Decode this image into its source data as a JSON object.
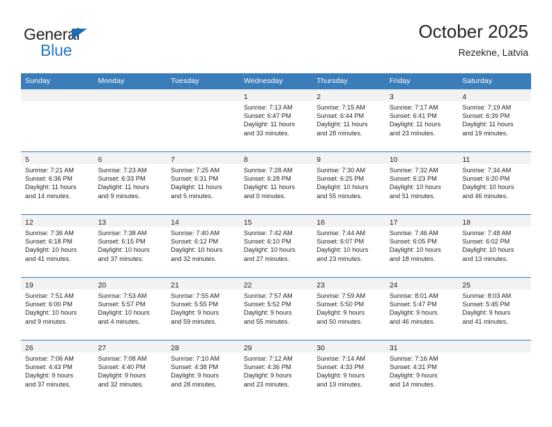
{
  "brand": {
    "name_top": "General",
    "name_bottom": "Blue",
    "triangle_icon": "triangle-icon",
    "accent_color": "#1f76c4"
  },
  "header": {
    "title": "October 2025",
    "subtitle": "Rezekne, Latvia"
  },
  "theme": {
    "header_bg": "#3b7cba",
    "header_text": "#ffffff",
    "daynum_band_bg": "#f2f2f2",
    "cell_bg": "#ffffff",
    "text": "#231f20"
  },
  "weekday_headers": [
    "Sunday",
    "Monday",
    "Tuesday",
    "Wednesday",
    "Thursday",
    "Friday",
    "Saturday"
  ],
  "labels": {
    "sunrise_prefix": "Sunrise:",
    "sunset_prefix": "Sunset:",
    "daylight_prefix": "Daylight:"
  },
  "weeks": [
    [
      {
        "empty": true
      },
      {
        "empty": true
      },
      {
        "empty": true
      },
      {
        "day": "1",
        "sunrise": "Sunrise: 7:13 AM",
        "sunset": "Sunset: 6:47 PM",
        "daylight_line1": "Daylight: 11 hours",
        "daylight_line2": "and 33 minutes."
      },
      {
        "day": "2",
        "sunrise": "Sunrise: 7:15 AM",
        "sunset": "Sunset: 6:44 PM",
        "daylight_line1": "Daylight: 11 hours",
        "daylight_line2": "and 28 minutes."
      },
      {
        "day": "3",
        "sunrise": "Sunrise: 7:17 AM",
        "sunset": "Sunset: 6:41 PM",
        "daylight_line1": "Daylight: 11 hours",
        "daylight_line2": "and 23 minutes."
      },
      {
        "day": "4",
        "sunrise": "Sunrise: 7:19 AM",
        "sunset": "Sunset: 6:39 PM",
        "daylight_line1": "Daylight: 11 hours",
        "daylight_line2": "and 19 minutes."
      }
    ],
    [
      {
        "day": "5",
        "sunrise": "Sunrise: 7:21 AM",
        "sunset": "Sunset: 6:36 PM",
        "daylight_line1": "Daylight: 11 hours",
        "daylight_line2": "and 14 minutes."
      },
      {
        "day": "6",
        "sunrise": "Sunrise: 7:23 AM",
        "sunset": "Sunset: 6:33 PM",
        "daylight_line1": "Daylight: 11 hours",
        "daylight_line2": "and 9 minutes."
      },
      {
        "day": "7",
        "sunrise": "Sunrise: 7:25 AM",
        "sunset": "Sunset: 6:31 PM",
        "daylight_line1": "Daylight: 11 hours",
        "daylight_line2": "and 5 minutes."
      },
      {
        "day": "8",
        "sunrise": "Sunrise: 7:28 AM",
        "sunset": "Sunset: 6:28 PM",
        "daylight_line1": "Daylight: 11 hours",
        "daylight_line2": "and 0 minutes."
      },
      {
        "day": "9",
        "sunrise": "Sunrise: 7:30 AM",
        "sunset": "Sunset: 6:25 PM",
        "daylight_line1": "Daylight: 10 hours",
        "daylight_line2": "and 55 minutes."
      },
      {
        "day": "10",
        "sunrise": "Sunrise: 7:32 AM",
        "sunset": "Sunset: 6:23 PM",
        "daylight_line1": "Daylight: 10 hours",
        "daylight_line2": "and 51 minutes."
      },
      {
        "day": "11",
        "sunrise": "Sunrise: 7:34 AM",
        "sunset": "Sunset: 6:20 PM",
        "daylight_line1": "Daylight: 10 hours",
        "daylight_line2": "and 46 minutes."
      }
    ],
    [
      {
        "day": "12",
        "sunrise": "Sunrise: 7:36 AM",
        "sunset": "Sunset: 6:18 PM",
        "daylight_line1": "Daylight: 10 hours",
        "daylight_line2": "and 41 minutes."
      },
      {
        "day": "13",
        "sunrise": "Sunrise: 7:38 AM",
        "sunset": "Sunset: 6:15 PM",
        "daylight_line1": "Daylight: 10 hours",
        "daylight_line2": "and 37 minutes."
      },
      {
        "day": "14",
        "sunrise": "Sunrise: 7:40 AM",
        "sunset": "Sunset: 6:12 PM",
        "daylight_line1": "Daylight: 10 hours",
        "daylight_line2": "and 32 minutes."
      },
      {
        "day": "15",
        "sunrise": "Sunrise: 7:42 AM",
        "sunset": "Sunset: 6:10 PM",
        "daylight_line1": "Daylight: 10 hours",
        "daylight_line2": "and 27 minutes."
      },
      {
        "day": "16",
        "sunrise": "Sunrise: 7:44 AM",
        "sunset": "Sunset: 6:07 PM",
        "daylight_line1": "Daylight: 10 hours",
        "daylight_line2": "and 23 minutes."
      },
      {
        "day": "17",
        "sunrise": "Sunrise: 7:46 AM",
        "sunset": "Sunset: 6:05 PM",
        "daylight_line1": "Daylight: 10 hours",
        "daylight_line2": "and 18 minutes."
      },
      {
        "day": "18",
        "sunrise": "Sunrise: 7:48 AM",
        "sunset": "Sunset: 6:02 PM",
        "daylight_line1": "Daylight: 10 hours",
        "daylight_line2": "and 13 minutes."
      }
    ],
    [
      {
        "day": "19",
        "sunrise": "Sunrise: 7:51 AM",
        "sunset": "Sunset: 6:00 PM",
        "daylight_line1": "Daylight: 10 hours",
        "daylight_line2": "and 9 minutes."
      },
      {
        "day": "20",
        "sunrise": "Sunrise: 7:53 AM",
        "sunset": "Sunset: 5:57 PM",
        "daylight_line1": "Daylight: 10 hours",
        "daylight_line2": "and 4 minutes."
      },
      {
        "day": "21",
        "sunrise": "Sunrise: 7:55 AM",
        "sunset": "Sunset: 5:55 PM",
        "daylight_line1": "Daylight: 9 hours",
        "daylight_line2": "and 59 minutes."
      },
      {
        "day": "22",
        "sunrise": "Sunrise: 7:57 AM",
        "sunset": "Sunset: 5:52 PM",
        "daylight_line1": "Daylight: 9 hours",
        "daylight_line2": "and 55 minutes."
      },
      {
        "day": "23",
        "sunrise": "Sunrise: 7:59 AM",
        "sunset": "Sunset: 5:50 PM",
        "daylight_line1": "Daylight: 9 hours",
        "daylight_line2": "and 50 minutes."
      },
      {
        "day": "24",
        "sunrise": "Sunrise: 8:01 AM",
        "sunset": "Sunset: 5:47 PM",
        "daylight_line1": "Daylight: 9 hours",
        "daylight_line2": "and 46 minutes."
      },
      {
        "day": "25",
        "sunrise": "Sunrise: 8:03 AM",
        "sunset": "Sunset: 5:45 PM",
        "daylight_line1": "Daylight: 9 hours",
        "daylight_line2": "and 41 minutes."
      }
    ],
    [
      {
        "day": "26",
        "sunrise": "Sunrise: 7:06 AM",
        "sunset": "Sunset: 4:43 PM",
        "daylight_line1": "Daylight: 9 hours",
        "daylight_line2": "and 37 minutes."
      },
      {
        "day": "27",
        "sunrise": "Sunrise: 7:08 AM",
        "sunset": "Sunset: 4:40 PM",
        "daylight_line1": "Daylight: 9 hours",
        "daylight_line2": "and 32 minutes."
      },
      {
        "day": "28",
        "sunrise": "Sunrise: 7:10 AM",
        "sunset": "Sunset: 4:38 PM",
        "daylight_line1": "Daylight: 9 hours",
        "daylight_line2": "and 28 minutes."
      },
      {
        "day": "29",
        "sunrise": "Sunrise: 7:12 AM",
        "sunset": "Sunset: 4:36 PM",
        "daylight_line1": "Daylight: 9 hours",
        "daylight_line2": "and 23 minutes."
      },
      {
        "day": "30",
        "sunrise": "Sunrise: 7:14 AM",
        "sunset": "Sunset: 4:33 PM",
        "daylight_line1": "Daylight: 9 hours",
        "daylight_line2": "and 19 minutes."
      },
      {
        "day": "31",
        "sunrise": "Sunrise: 7:16 AM",
        "sunset": "Sunset: 4:31 PM",
        "daylight_line1": "Daylight: 9 hours",
        "daylight_line2": "and 14 minutes."
      },
      {
        "empty": true
      }
    ]
  ]
}
